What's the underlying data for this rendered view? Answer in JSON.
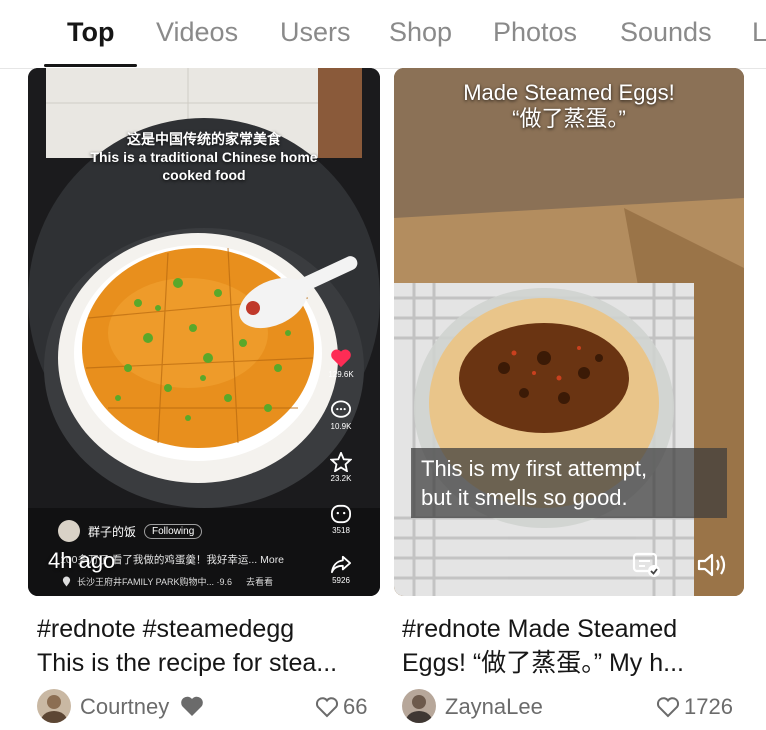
{
  "tabs": [
    {
      "label": "Top",
      "active": true
    },
    {
      "label": "Videos"
    },
    {
      "label": "Users"
    },
    {
      "label": "Shop"
    },
    {
      "label": "Photos"
    },
    {
      "label": "Sounds"
    },
    {
      "label": "L"
    }
  ],
  "card1": {
    "caption_cn": "这是中国传统的家常美食",
    "caption_en_1": "This is a traditional Chinese home",
    "caption_en_2": "cooked food",
    "likes_count": "129.6K",
    "comments_count": "10.9K",
    "favorites_count": "23.2K",
    "share_a_count": "3518",
    "share_b_count": "5926",
    "creator_name": "群子的饭",
    "follow_label": "Following",
    "description": "100多万了 看了我做的鸡蛋羹！我好幸运... More",
    "time_ago": "4h ago",
    "location": "长沙王府井FAMILY PARK购物中... ·9.6",
    "location_action": "去看看",
    "title_line1": "#rednote #steamedegg",
    "title_line2": "This is the recipe for stea...",
    "author": "Courtney",
    "likes": "66"
  },
  "card2": {
    "caption_top_1": "Made Steamed Eggs!",
    "caption_top_2": "“做了蒸蛋。”",
    "caption_bottom_1": "This is my first attempt,",
    "caption_bottom_2": "but it smells so good.",
    "title_line1": "#rednote Made Steamed",
    "title_line2": "Eggs! “做了蒸蛋。” My h...",
    "author": "ZaynaLee",
    "likes": "1726"
  },
  "colors": {
    "accent_heart": "#fe2c55",
    "text_primary": "#161616",
    "text_secondary": "#8a8a8a"
  }
}
